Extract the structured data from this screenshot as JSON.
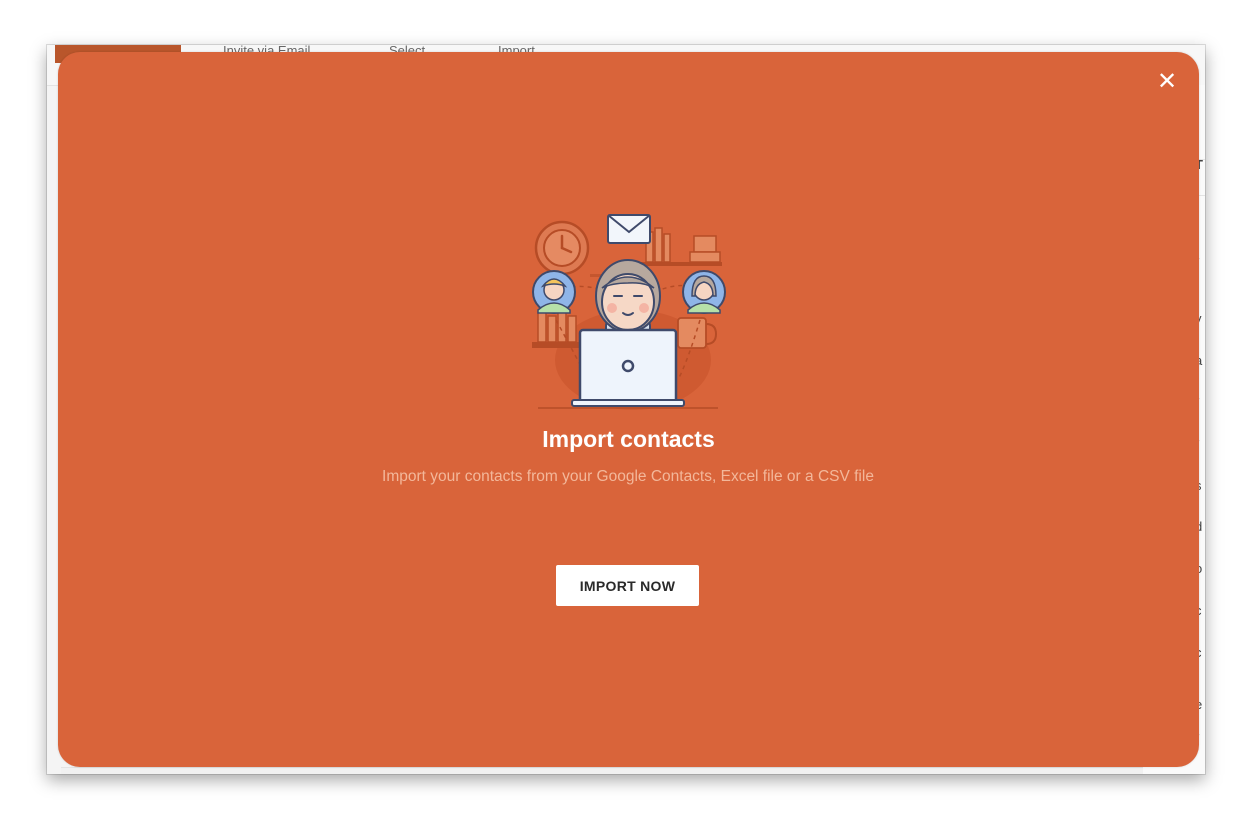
{
  "background_app": {
    "tabs": [
      "Invite via Email",
      "Select",
      "Import"
    ],
    "brand_color": "#b9562b"
  },
  "modal": {
    "background_color": "#d9643a",
    "close_icon": "close-icon",
    "illustration": "person-at-laptop-with-contacts-illustration",
    "title": "Import contacts",
    "description": "Import your contacts from your Google Contacts, Excel file or a CSV file",
    "cta_label": "IMPORT NOW"
  }
}
